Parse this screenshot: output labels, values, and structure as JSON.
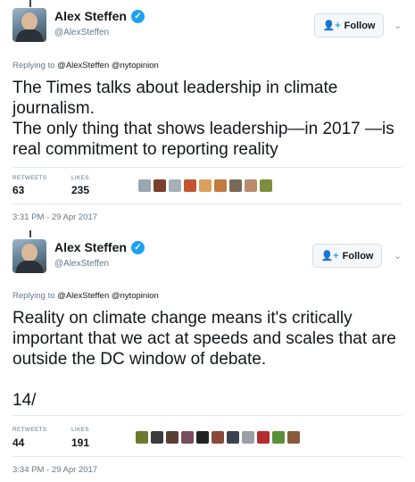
{
  "tweets": [
    {
      "author": {
        "name": "Alex Steffen",
        "handle": "@AlexSteffen"
      },
      "follow_label": "Follow",
      "replying_to_prefix": "Replying to",
      "replying_to": [
        "@AlexSteffen",
        "@nytopinion"
      ],
      "text": "The Times talks about leadership in climate journalism.\nThe only thing that shows leadership—in 2017 —is real commitment to reporting reality",
      "retweets_label": "RETWEETS",
      "retweets": "63",
      "likes_label": "LIKES",
      "likes": "235",
      "timestamp": "3:31 PM - 29 Apr 2017",
      "liker_colors": [
        "#9aa7b1",
        "#7b3f2a",
        "#a6b0b8",
        "#c2552f",
        "#d9a25b",
        "#c47a3f",
        "#7a6a55",
        "#b88c6d",
        "#7d8f3a"
      ]
    },
    {
      "author": {
        "name": "Alex Steffen",
        "handle": "@AlexSteffen"
      },
      "follow_label": "Follow",
      "replying_to_prefix": "Replying to",
      "replying_to": [
        "@AlexSteffen",
        "@nytopinion"
      ],
      "text": "Reality on climate change means it's critically important that we act at speeds and scales that are outside the DC window of debate.\n\n14/",
      "retweets_label": "RETWEETS",
      "retweets": "44",
      "likes_label": "LIKES",
      "likes": "191",
      "timestamp": "3:34 PM - 29 Apr 2017",
      "liker_colors": [
        "#6d7a2e",
        "#3b3b3b",
        "#5a3d33",
        "#7a4d5e",
        "#222222",
        "#8a4a3a",
        "#3a4450",
        "#9aa0a6",
        "#b32d2d",
        "#5d8f3a",
        "#8a5a3a"
      ]
    }
  ]
}
